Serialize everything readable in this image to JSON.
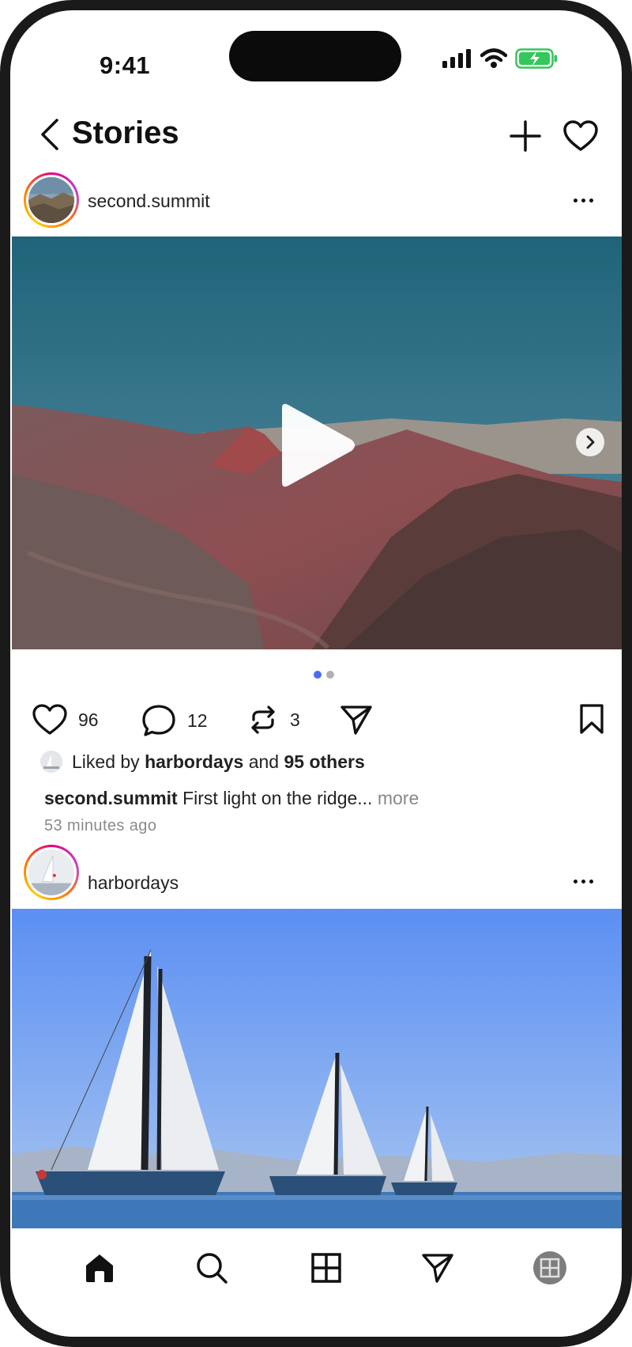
{
  "status_bar": {
    "time": "9:41"
  },
  "header": {
    "title": "Stories"
  },
  "posts": [
    {
      "username": "second.summit",
      "likes_count": "96",
      "comments_count": "12",
      "reposts_count": "3",
      "liked_by_user": "harbordays",
      "liked_by_others": "95 others",
      "liked_prefix": "Liked by",
      "liked_and": "and",
      "caption_user": "second.summit",
      "caption_text": "First light on the ridge...",
      "caption_more": "more",
      "timestamp": "53 minutes ago"
    },
    {
      "username": "harbordays"
    }
  ],
  "colors": {
    "accent_dot": "#4a6cf7",
    "battery": "#34c759",
    "story_ring": "#e6007e"
  },
  "icons": {
    "nav": [
      "home-icon",
      "search-icon",
      "grid-icon",
      "send-icon",
      "profile-icon"
    ]
  }
}
